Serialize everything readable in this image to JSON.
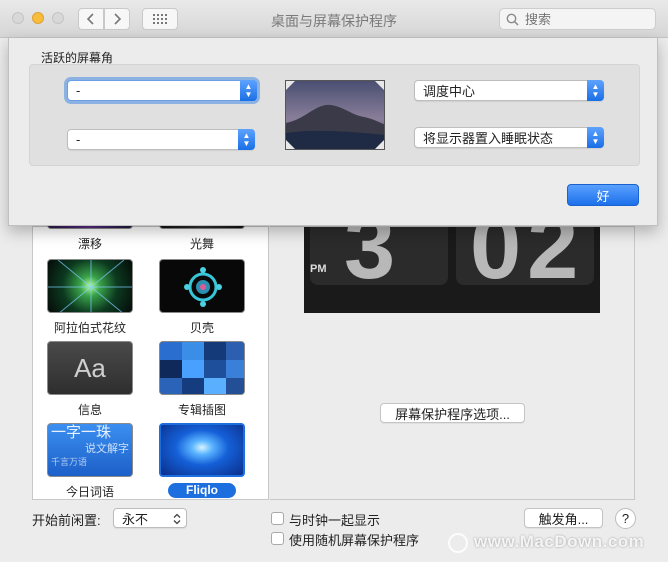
{
  "window": {
    "title": "桌面与屏幕保护程序",
    "search_placeholder": "搜索"
  },
  "sheet": {
    "group_title": "活跃的屏幕角",
    "corners": {
      "top_left": "-",
      "bottom_left": "-",
      "top_right": "调度中心",
      "bottom_right": "将显示器置入睡眠状态"
    },
    "ok_label": "好"
  },
  "screensavers": [
    {
      "label": "漂移"
    },
    {
      "label": "光舞"
    },
    {
      "label": "阿拉伯式花纹"
    },
    {
      "label": "贝壳"
    },
    {
      "label": "信息",
      "thumb_text": "Aa"
    },
    {
      "label": "专辑插图"
    },
    {
      "label": "今日词语",
      "thumb_lines": [
        "一字一珠",
        "说文解字",
        "千言万语"
      ]
    },
    {
      "label": "Fliqlo",
      "selected": true
    }
  ],
  "preview": {
    "clock_hour": "3",
    "clock_minute": "02",
    "am_pm": "PM",
    "options_button": "屏幕保护程序选项..."
  },
  "bottom": {
    "start_after_label": "开始前闲置:",
    "start_after_value": "永不",
    "show_with_clock": "与时钟一起显示",
    "use_random": "使用随机屏幕保护程序",
    "hot_corners_button": "触发角...",
    "help": "?"
  },
  "watermark": "www.MacDown.com",
  "colors": {
    "accent": "#1c70ea",
    "selected_label_bg": "#1d6fe0",
    "minimize_yellow": "#f7bd3b"
  },
  "icons": [
    "back-chevron-icon",
    "forward-chevron-icon",
    "grid-icon",
    "search-icon",
    "stepper-icon"
  ]
}
